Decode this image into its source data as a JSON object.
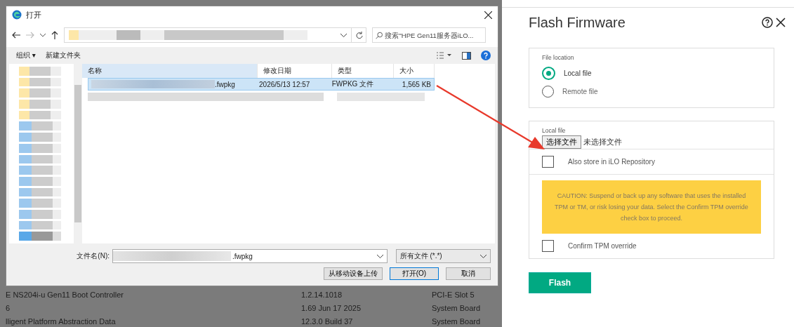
{
  "dialog": {
    "title": "打开",
    "search": {
      "placeholder": "搜索\"HPE Gen11服务器iLO..."
    },
    "toolbar": [
      "组织 ▾",
      "新建文件夹"
    ],
    "columns": [
      "名称",
      "修改日期",
      "类型",
      "大小"
    ],
    "files": [
      {
        "name_suffix": ".fwpkg",
        "date": "2026/5/13 12:57",
        "type": "FWPKG 文件",
        "size": "1,565 KB",
        "selected": true
      },
      {
        "selected": false
      }
    ],
    "filename_label": "文件名(N):",
    "filename_value": ".fwpkg",
    "filter": "所有文件 (*.*)",
    "buttons": [
      "从移动设备上传",
      "打开(O)",
      "取消"
    ]
  },
  "background_table": {
    "rows": [
      [
        "E NS204i-u Gen11 Boot Controller",
        "1.2.14.1018",
        "PCI-E Slot 5"
      ],
      [
        "6",
        "1.69 Jun 17 2025",
        "System Board"
      ],
      [
        "lligent Platform Abstraction Data",
        "12.3.0 Build 37",
        "System Board"
      ]
    ]
  },
  "flash_panel": {
    "title": "Flash Firmware",
    "location_label": "File location",
    "options": [
      {
        "label": "Local file",
        "selected": true
      },
      {
        "label": "Remote file",
        "selected": false
      }
    ],
    "local_file_label": "Local file",
    "choose_button": "选择文件",
    "no_file": "未选择文件",
    "checks": [
      {
        "kind": "store",
        "label": "Also store in iLO Repository",
        "checked": false
      },
      {
        "kind": "caution",
        "text": "CAUTION: Suspend or back up any software that uses the installed TPM or TM, or risk losing your data. Select the Confirm TPM override check box to proceed."
      },
      {
        "kind": "store",
        "label": "Confirm TPM override",
        "checked": false
      }
    ],
    "flash_button": "Flash"
  }
}
